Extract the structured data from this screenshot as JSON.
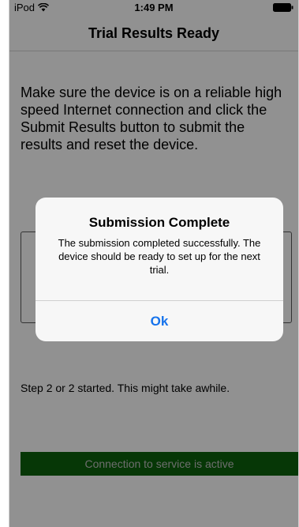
{
  "status_bar": {
    "carrier": "iPod",
    "time": "1:49 PM",
    "wifi_icon": "wifi-icon",
    "battery_icon": "battery-icon"
  },
  "nav": {
    "title": "Trial Results Ready"
  },
  "main": {
    "instructions": "Make sure the device is on a reliable high speed Internet connection and click the Submit Results button to submit the results and reset the device.",
    "step_text": "Step 2 or 2 started.  This might take awhile.",
    "connection_status": "Connection to service is active",
    "connection_color": "#0a5c0a"
  },
  "alert": {
    "title": "Submission Complete",
    "message": "The submission completed successfully.  The device should be ready to set up for the next trial.",
    "ok_label": "Ok",
    "ok_color": "#1673ec"
  }
}
